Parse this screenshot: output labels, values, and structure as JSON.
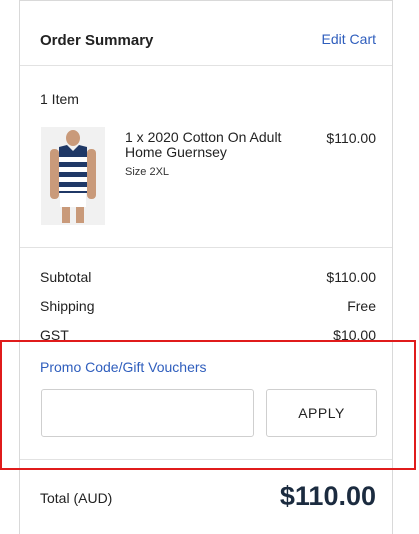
{
  "summary": {
    "title": "Order Summary",
    "edit_cart": "Edit Cart",
    "item_count": "1 Item"
  },
  "product": {
    "name": "1 x 2020 Cotton On Adult Home Guernsey",
    "size": "Size 2XL",
    "price": "$110.00",
    "image_icon": "guernsey-icon"
  },
  "totals": {
    "subtotal_label": "Subtotal",
    "subtotal_value": "$110.00",
    "shipping_label": "Shipping",
    "shipping_value": "Free",
    "gst_label": "GST",
    "gst_value": "$10.00",
    "total_label": "Total (AUD)",
    "total_value": "$110.00"
  },
  "promo": {
    "label": "Promo Code/Gift Vouchers",
    "input_value": "",
    "apply_label": "APPLY"
  },
  "colors": {
    "link": "#2f5ebd",
    "highlight": "#e01b1b",
    "total": "#1b2b3f"
  }
}
